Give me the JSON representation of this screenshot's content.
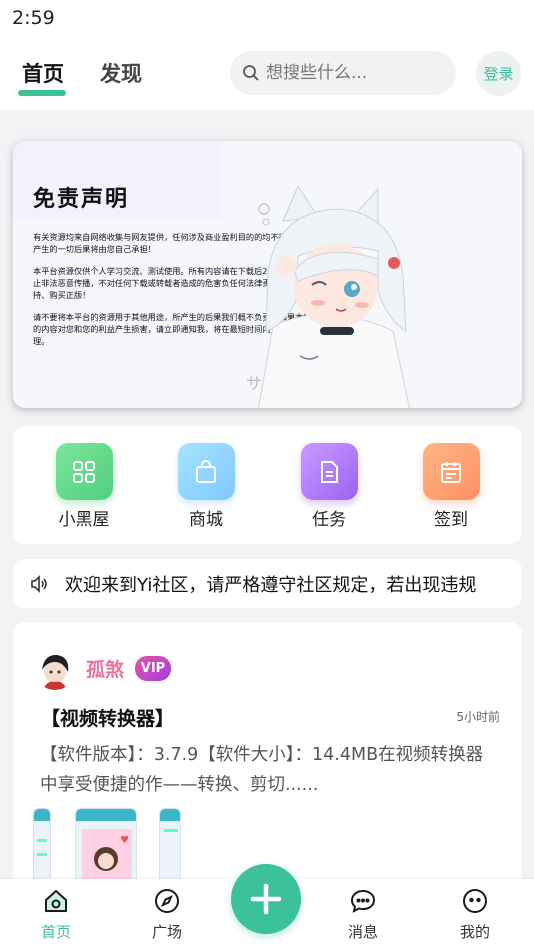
{
  "status_bar": {
    "time": "2:59"
  },
  "header": {
    "tabs": [
      {
        "label": "首页",
        "active": true
      },
      {
        "label": "发现",
        "active": false
      }
    ],
    "search": {
      "placeholder": "想搜些什么..."
    },
    "login_label": "登录"
  },
  "banner": {
    "title": "免责声明",
    "paragraphs": [
      "有关资源均来自网络收集与网友提供，任何涉及商业盈利目的的均不得使用，否则产生的一切后果将由您自己承担！",
      "本平台资源仅供个人学习交流、测试使用。所有内容请在下载后24小时内删除，禁止非法恶意传播，不对任何下载或转载者造成的危害负任何法律责任！也请大家支持、购买正版！",
      "请不要将本平台的资源用于其他用途，所产生的后果我们概不负责！如果本帖存在的内容对您和您的利益产生损害，请立即通知我，将在最短时间内对其做出删除处理。"
    ]
  },
  "shortcuts": [
    {
      "label": "小黑屋",
      "icon": "grid-icon",
      "color": "#5bd47f"
    },
    {
      "label": "商城",
      "icon": "shopping-bag-icon",
      "color": "#8fd0ff"
    },
    {
      "label": "任务",
      "icon": "document-icon",
      "color": "#a872f5"
    },
    {
      "label": "签到",
      "icon": "calendar-icon",
      "color": "#ff9a6a"
    }
  ],
  "notice": {
    "icon": "speaker-icon",
    "text": "欢迎来到Yi社区，请严格遵守社区规定，若出现违规"
  },
  "post": {
    "username": "孤煞",
    "badge": "VIP",
    "title": "【视频转换器】",
    "time": "5小时前",
    "excerpt": "【软件版本】：3.7.9【软件大小】：14.4MB在视频转换器中享受便捷的作——转换、剪切......"
  },
  "bottom_nav": [
    {
      "label": "首页",
      "icon": "home-icon",
      "active": true
    },
    {
      "label": "广场",
      "icon": "compass-icon",
      "active": false
    },
    {
      "label": "消息",
      "icon": "chat-icon",
      "active": false
    },
    {
      "label": "我的",
      "icon": "profile-face-icon",
      "active": false
    }
  ],
  "fab_icon": "plus-icon",
  "colors": {
    "accent": "#3cc29a",
    "vip_pink": "#f06fa2"
  }
}
